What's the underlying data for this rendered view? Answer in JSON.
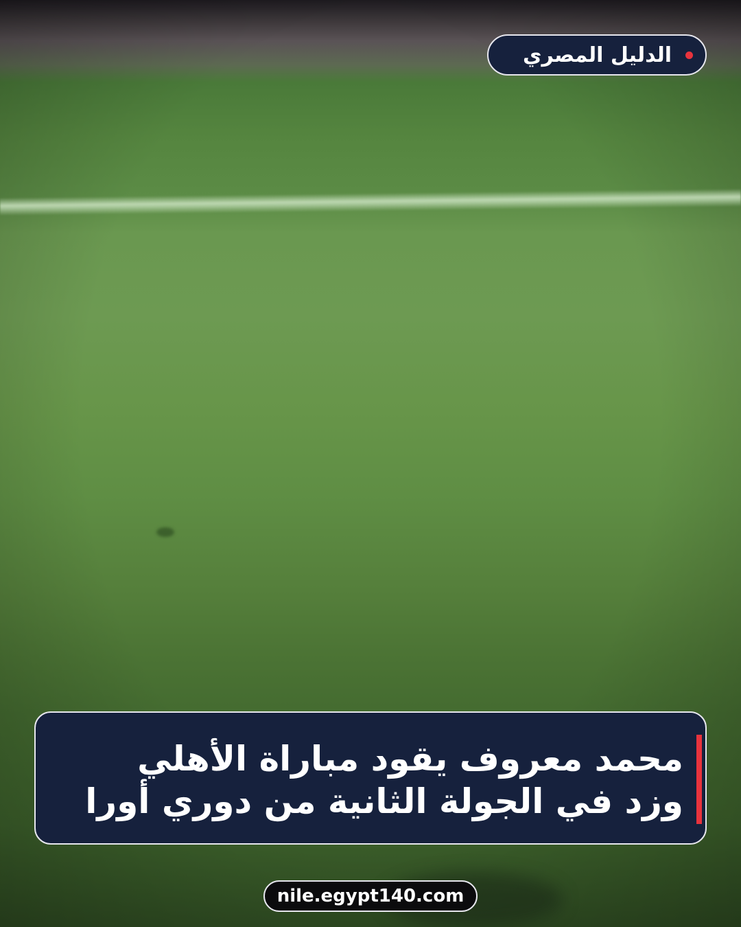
{
  "brand": {
    "name": "الدليل المصري",
    "dot_color": "#e8333d",
    "pill_color": "#16213d"
  },
  "headline": {
    "line1": "محمد معروف يقود مباراة الأهلي",
    "line2": "وزد في الجولة الثانية من دوري أورا",
    "accent_color": "#e8333d"
  },
  "footer": {
    "url": "nile.egypt140.com"
  },
  "background": {
    "description_icon": "football-pitch-photo"
  }
}
